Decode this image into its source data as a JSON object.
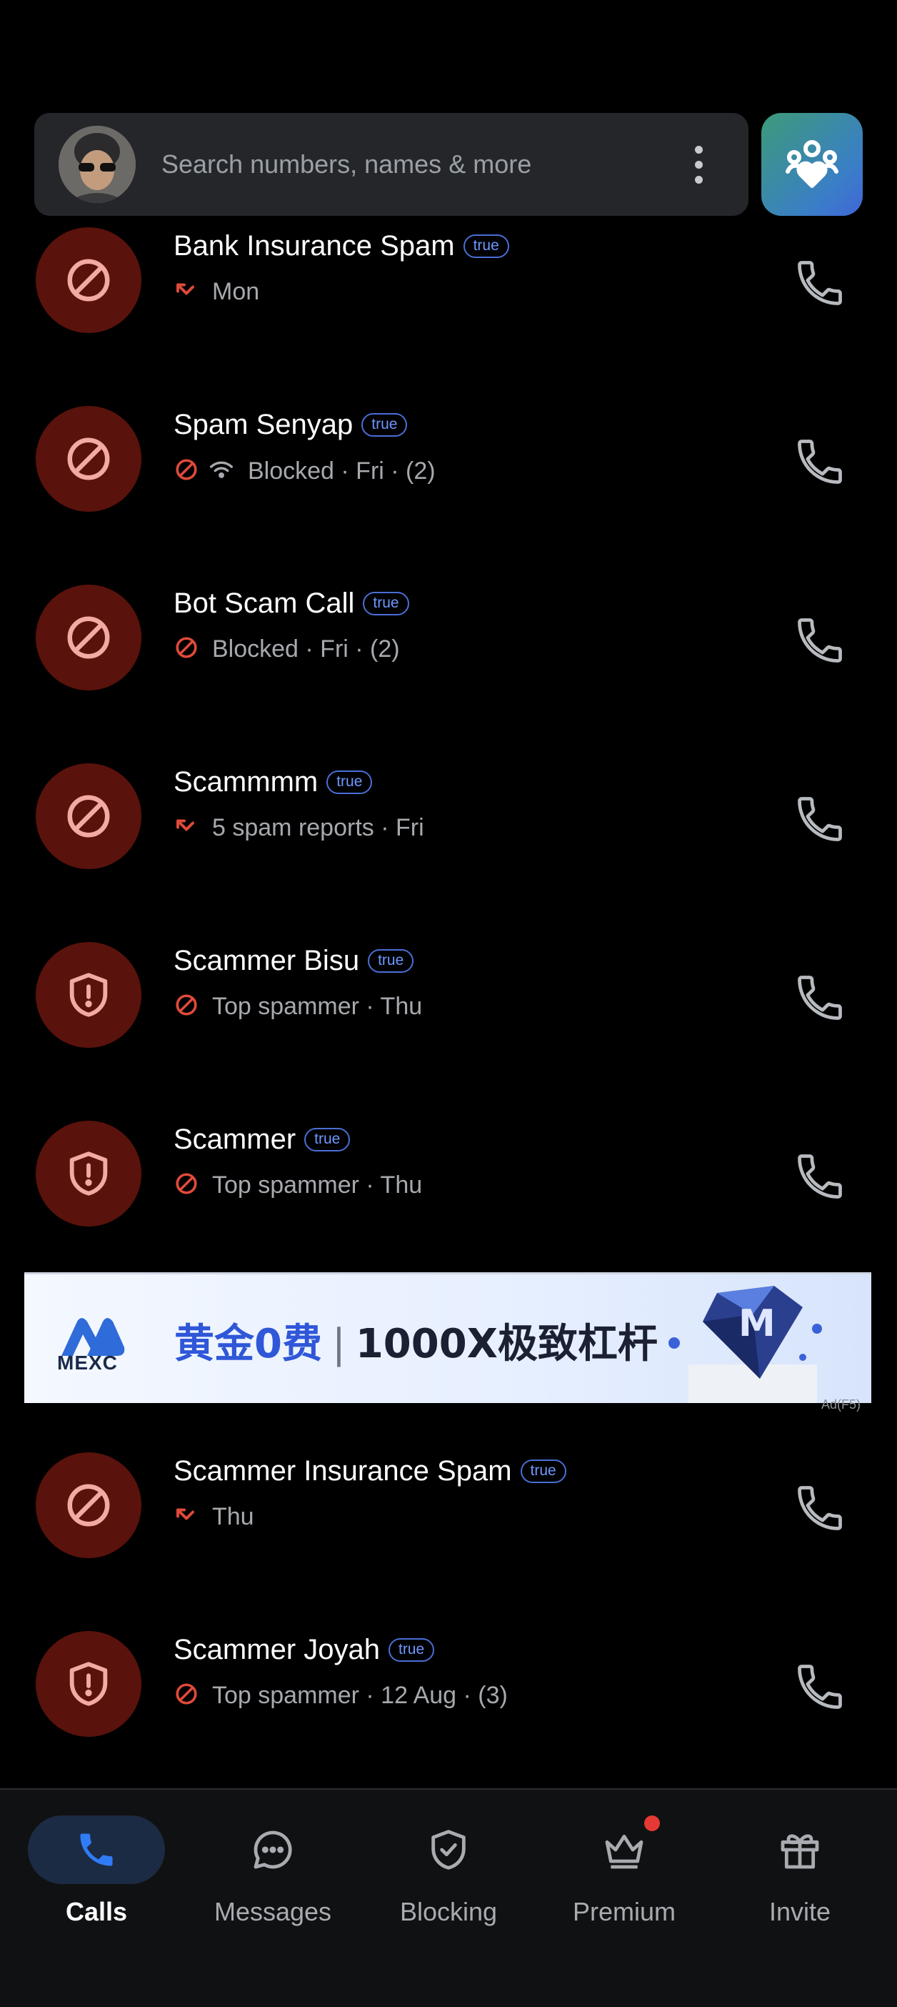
{
  "search": {
    "placeholder": "Search numbers, names & more"
  },
  "calls": [
    {
      "name": "Bank Insurance Spam",
      "badge": "true",
      "icon": "block-icon",
      "status_icon": "missed-call-icon",
      "detail": "Mon"
    },
    {
      "name": "Spam Senyap",
      "badge": "true",
      "icon": "block-icon",
      "status_icon": "blocked-icon",
      "detail": "Blocked · Fri · (2)"
    },
    {
      "name": "Bot Scam Call",
      "badge": "true",
      "icon": "block-icon",
      "status_icon": "blocked-icon",
      "detail": "Blocked · Fri · (2)"
    },
    {
      "name": "Scammmm",
      "badge": "true",
      "icon": "block-icon",
      "status_icon": "missed-call-icon",
      "detail": "5 spam reports · Fri"
    },
    {
      "name": "Scammer Bisu",
      "badge": "true",
      "icon": "shield-alert-icon",
      "status_icon": "blocked-icon",
      "detail": "Top spammer · Thu"
    },
    {
      "name": "Scammer",
      "badge": "true",
      "icon": "shield-alert-icon",
      "status_icon": "blocked-icon",
      "detail": "Top spammer · Thu"
    },
    {
      "name": "Scammer Insurance Spam",
      "badge": "true",
      "icon": "block-icon",
      "status_icon": "missed-call-icon",
      "detail": "Thu"
    },
    {
      "name": "Scammer Joyah",
      "badge": "true",
      "icon": "shield-alert-icon",
      "status_icon": "blocked-icon",
      "detail": "Top spammer · 12 Aug · (3)"
    }
  ],
  "ad": {
    "brand": "MEXC",
    "headline_part1": "黄金0费",
    "separator": "|",
    "headline_part2": "1000X极致杠杆",
    "tag": "Ad(F5)"
  },
  "nav": {
    "items": [
      {
        "label": "Calls",
        "icon": "phone-icon",
        "active": true
      },
      {
        "label": "Messages",
        "icon": "chat-icon",
        "active": false
      },
      {
        "label": "Blocking",
        "icon": "shield-check-icon",
        "active": false
      },
      {
        "label": "Premium",
        "icon": "crown-icon",
        "active": false,
        "notification": true
      },
      {
        "label": "Invite",
        "icon": "gift-icon",
        "active": false
      }
    ]
  },
  "colors": {
    "accent_blue": "#2f6fe0",
    "spam_red": "#e04a3a",
    "spam_circle": "#5a120c",
    "badge_blue": "#6f97ff"
  }
}
